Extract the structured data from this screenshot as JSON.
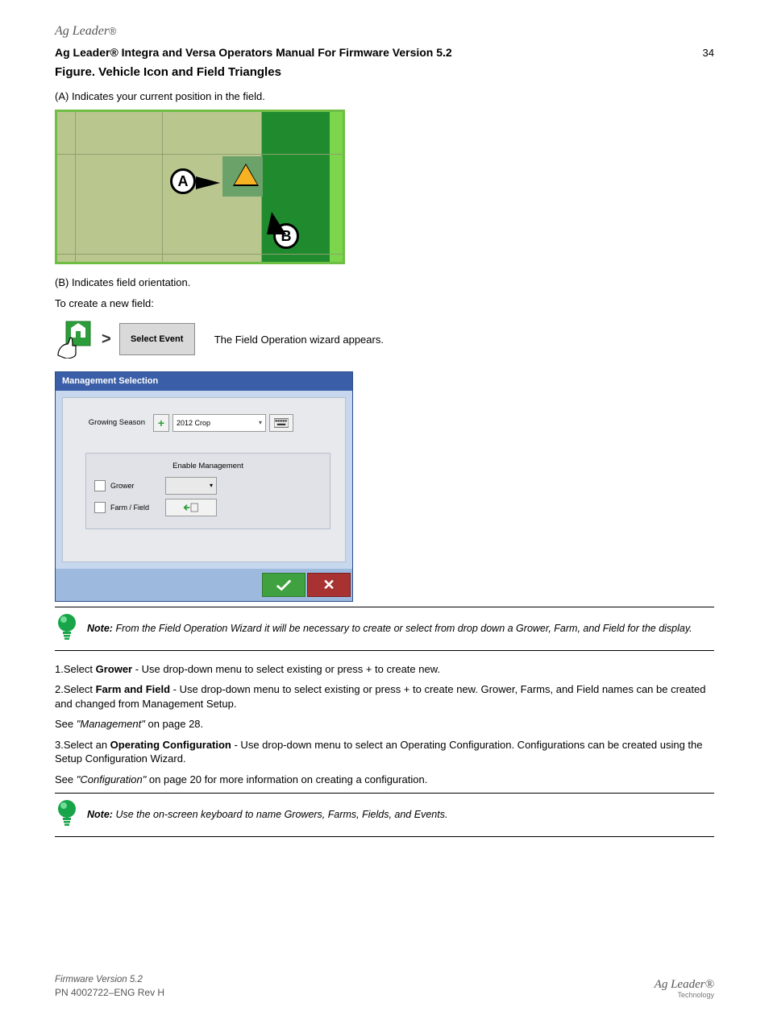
{
  "header": {
    "brand": "Ag Leader",
    "manual_title": "Ag Leader® Integra and Versa Operators Manual For Firmware Version 5.2",
    "page": "34",
    "section_title": "Figure. Vehicle Icon and Field Triangles"
  },
  "callouts": {
    "a_label": "A",
    "a_desc": "(A) Indicates your current position in the field.",
    "b_label": "B",
    "b_desc": "(B) Indicates field orientation."
  },
  "path": {
    "lead": "To create a new field:",
    "home_name": "home",
    "breadcrumb_btn": "Select Event",
    "arrow_text": "The Field Operation wizard appears."
  },
  "dialog": {
    "title": "Management Selection",
    "field_label": "Growing Season",
    "dropdown_value": "2012 Crop",
    "sub_title": "Enable Management",
    "row1_label": "Grower",
    "row2_label": "Farm / Field",
    "btn_load": "load"
  },
  "notes": {
    "n1": "Note: From the Field Operation Wizard it will be necessary to create or select from drop down a Grower, Farm, and Field for the display.",
    "n2": "Note: Use the on-screen keyboard to name Growers, Farms, Fields, and Events."
  },
  "steps": {
    "s1_a": "1.Select ",
    "s1_b": "Grower",
    "s1_c": " - Use drop-down menu to select existing or press + to create new.",
    "s2_a": "2.Select ",
    "s2_b": "Farm and Field",
    "s2_c": " - Use drop-down menu to select existing or press + to create new. Grower, Farms, and Field names can be created and changed from Management Setup.",
    "s2_d": "See ",
    "s2_e": "\"Management\"",
    "s2_f": " on page 28.",
    "s3_a": "3.Select an ",
    "s3_b": "Operating Configuration",
    "s3_c": " - Use drop-down menu to select an Operating Configuration. Configurations can be created using the Setup Configuration Wizard.",
    "s3_d": "See ",
    "s3_e": "\"Configuration\"",
    "s3_f": " on page 20 for more information on creating a configuration."
  },
  "footer": {
    "rev": "Firmware Version 5.2",
    "pn": "PN 4002722–ENG Rev H",
    "brand_top": "Ag Leader",
    "brand_sub": "Technology"
  }
}
